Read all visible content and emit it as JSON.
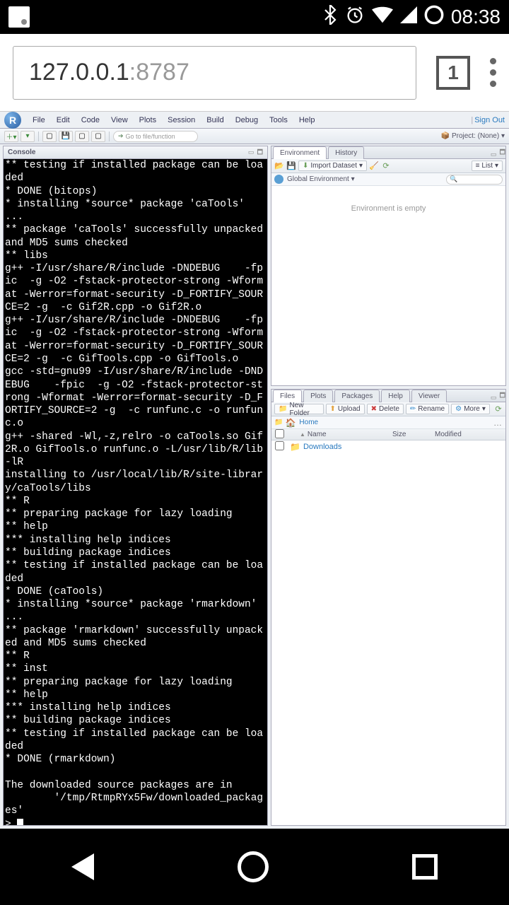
{
  "status": {
    "time": "08:38"
  },
  "browser": {
    "url_host": "127.0.0.1",
    "url_port": ":8787",
    "tab_count": "1"
  },
  "menu": {
    "items": [
      "File",
      "Edit",
      "Code",
      "View",
      "Plots",
      "Session",
      "Build",
      "Debug",
      "Tools",
      "Help"
    ],
    "sign_out": "Sign Out"
  },
  "toolbar": {
    "goto_placeholder": "Go to file/function",
    "project_label": "Project: (None)"
  },
  "console": {
    "tab": "Console",
    "output": "** testing if installed package can be loaded\n* DONE (bitops)\n* installing *source* package 'caTools' ...\n** package 'caTools' successfully unpacked and MD5 sums checked\n** libs\ng++ -I/usr/share/R/include -DNDEBUG    -fpic  -g -O2 -fstack-protector-strong -Wformat -Werror=format-security -D_FORTIFY_SOURCE=2 -g  -c Gif2R.cpp -o Gif2R.o\ng++ -I/usr/share/R/include -DNDEBUG    -fpic  -g -O2 -fstack-protector-strong -Wformat -Werror=format-security -D_FORTIFY_SOURCE=2 -g  -c GifTools.cpp -o GifTools.o\ngcc -std=gnu99 -I/usr/share/R/include -DNDEBUG    -fpic  -g -O2 -fstack-protector-strong -Wformat -Werror=format-security -D_FORTIFY_SOURCE=2 -g  -c runfunc.c -o runfunc.o\ng++ -shared -Wl,-z,relro -o caTools.so Gif2R.o GifTools.o runfunc.o -L/usr/lib/R/lib -lR\ninstalling to /usr/local/lib/R/site-library/caTools/libs\n** R\n** preparing package for lazy loading\n** help\n*** installing help indices\n** building package indices\n** testing if installed package can be loaded\n* DONE (caTools)\n* installing *source* package 'rmarkdown' ...\n** package 'rmarkdown' successfully unpacked and MD5 sums checked\n** R\n** inst\n** preparing package for lazy loading\n** help\n*** installing help indices\n** building package indices\n** testing if installed package can be loaded\n* DONE (rmarkdown)\n\nThe downloaded source packages are in\n        '/tmp/RtmpRYx5Fw/downloaded_packages'\n> "
  },
  "env": {
    "tabs": [
      "Environment",
      "History"
    ],
    "import": "Import Dataset",
    "list": "List",
    "scope": "Global Environment",
    "empty": "Environment is empty"
  },
  "files": {
    "tabs": [
      "Files",
      "Plots",
      "Packages",
      "Help",
      "Viewer"
    ],
    "buttons": {
      "new_folder": "New Folder",
      "upload": "Upload",
      "delete": "Delete",
      "rename": "Rename",
      "more": "More"
    },
    "crumb_home": "Home",
    "headers": {
      "name": "Name",
      "size": "Size",
      "modified": "Modified"
    },
    "rows": [
      {
        "name": "Downloads"
      }
    ]
  }
}
